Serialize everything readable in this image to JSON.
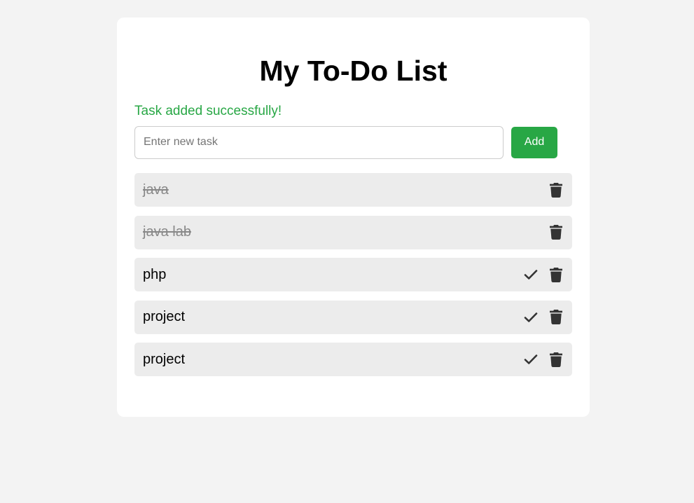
{
  "app": {
    "title": "My To-Do List"
  },
  "status_message": "Task added successfully!",
  "new_task": {
    "value": "",
    "placeholder": "Enter new task",
    "add_label": "Add"
  },
  "tasks": [
    {
      "text": "java",
      "completed": true
    },
    {
      "text": "java lab",
      "completed": true
    },
    {
      "text": "php",
      "completed": false
    },
    {
      "text": "project",
      "completed": false
    },
    {
      "text": "project",
      "completed": false
    }
  ],
  "icons": {
    "complete": "check-icon",
    "delete": "trash-icon"
  },
  "colors": {
    "page_background": "#f3f3f3",
    "card_background": "#ffffff",
    "accent": "#28a745",
    "task_background": "#ececec",
    "completed_text": "#888888",
    "icon": "#333333"
  }
}
